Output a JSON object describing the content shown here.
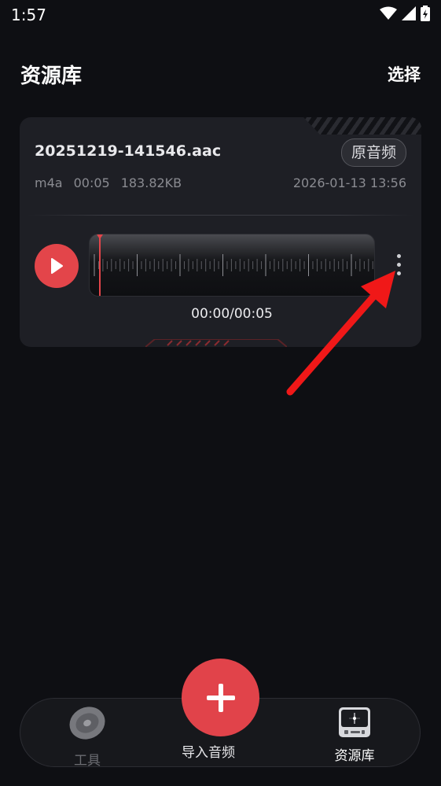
{
  "status_bar": {
    "time": "1:57"
  },
  "header": {
    "title": "资源库",
    "select_label": "选择"
  },
  "card": {
    "file_name": "20251219-141546.aac",
    "source_badge": "原音频",
    "format": "m4a",
    "duration": "00:05",
    "size": "183.82KB",
    "date": "2026-01-13 13:56",
    "time_readout": "00:00/00:05"
  },
  "bottom_nav": {
    "tools_label": "工具",
    "import_label": "导入音频",
    "library_label": "资源库"
  },
  "colors": {
    "accent": "#e3454a",
    "background": "#0e0f13",
    "card": "#1e1f25"
  }
}
